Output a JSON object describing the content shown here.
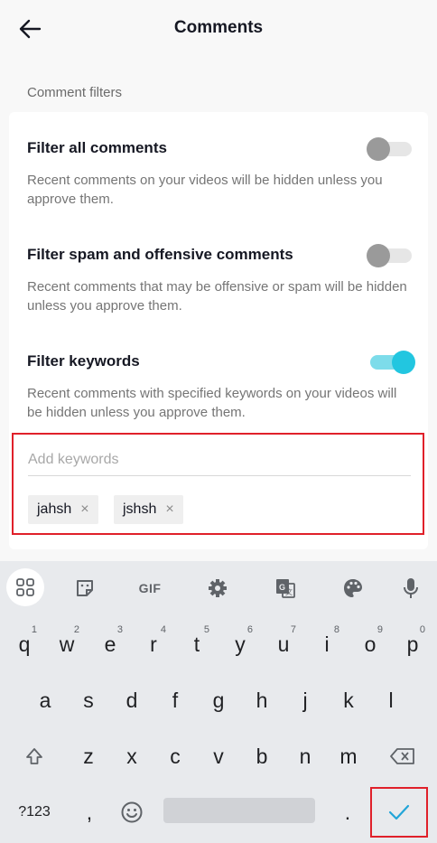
{
  "header": {
    "title": "Comments",
    "back_icon": "arrow-left-icon"
  },
  "section": {
    "label": "Comment filters"
  },
  "filters": [
    {
      "title": "Filter all comments",
      "description": "Recent comments on your videos will be hidden unless you approve them.",
      "enabled": false
    },
    {
      "title": "Filter spam and offensive comments",
      "description": "Recent comments that may be offensive or spam will be hidden unless you approve them.",
      "enabled": false
    },
    {
      "title": "Filter keywords",
      "description": "Recent comments with specified keywords on your videos will be hidden unless you approve them.",
      "enabled": true
    }
  ],
  "keywords": {
    "input_value": "",
    "placeholder": "Add keywords",
    "chips": [
      "jahsh",
      "jshsh"
    ],
    "remove_symbol": "×"
  },
  "keyboard": {
    "toolbar": {
      "apps_icon": "grid-icon",
      "sticker_icon": "sticker-icon",
      "gif_label": "GIF",
      "settings_icon": "gear-icon",
      "translate_icon": "translate-icon",
      "theme_icon": "palette-icon",
      "mic_icon": "microphone-icon"
    },
    "row1": [
      {
        "key": "q",
        "hint": "1"
      },
      {
        "key": "w",
        "hint": "2"
      },
      {
        "key": "e",
        "hint": "3"
      },
      {
        "key": "r",
        "hint": "4"
      },
      {
        "key": "t",
        "hint": "5"
      },
      {
        "key": "y",
        "hint": "6"
      },
      {
        "key": "u",
        "hint": "7"
      },
      {
        "key": "i",
        "hint": "8"
      },
      {
        "key": "o",
        "hint": "9"
      },
      {
        "key": "p",
        "hint": "0"
      }
    ],
    "row2": [
      "a",
      "s",
      "d",
      "f",
      "g",
      "h",
      "j",
      "k",
      "l"
    ],
    "row3": [
      "z",
      "x",
      "c",
      "v",
      "b",
      "n",
      "m"
    ],
    "shift_icon": "shift-arrow-icon",
    "backspace_icon": "backspace-icon",
    "symbols_label": "?123",
    "comma_label": ",",
    "emoji_icon": "emoji-icon",
    "period_label": ".",
    "enter_icon": "checkmark-icon"
  },
  "colors": {
    "accent": "#22c6e0",
    "highlight": "#e0202a"
  }
}
